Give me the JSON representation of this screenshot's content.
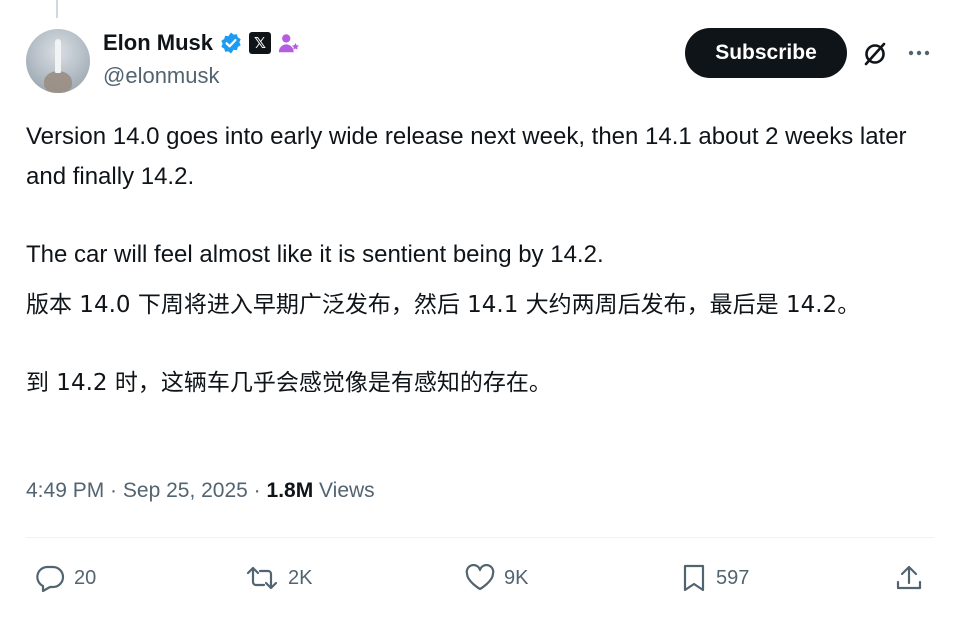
{
  "author": {
    "name": "Elon Musk",
    "handle": "@elonmusk",
    "verified_icon": "verified-badge-icon",
    "affiliation_icon": "x-logo-badge-icon",
    "extra_icon": "person-sparkle-icon"
  },
  "header": {
    "subscribe_label": "Subscribe",
    "grok_icon": "grok-icon",
    "more_icon": "more-options-icon"
  },
  "tweet": {
    "paragraphs": [
      "Version 14.0 goes into early wide release next week, then 14.1 about 2 weeks later and finally 14.2.",
      "The car will feel almost like it is sentient being by 14.2.",
      "版本 14.0 下周将进入早期广泛发布，然后 14.1 大约两周后发布，最后是 14.2。",
      "到 14.2 时，这辆车几乎会感觉像是有感知的存在。"
    ]
  },
  "meta": {
    "time": "4:49 PM",
    "separator": " · ",
    "date": "Sep 25, 2025",
    "views_count": "1.8M",
    "views_label": "Views"
  },
  "actions": {
    "replies": "20",
    "reposts": "2K",
    "likes": "9K",
    "bookmarks": "597"
  },
  "colors": {
    "text_primary": "#0f1419",
    "text_secondary": "#536471",
    "verified_blue": "#1d9bf0",
    "subscribe_bg": "#0f1419",
    "accent_purple": "#b65ce0",
    "divider": "#eff3f4"
  }
}
